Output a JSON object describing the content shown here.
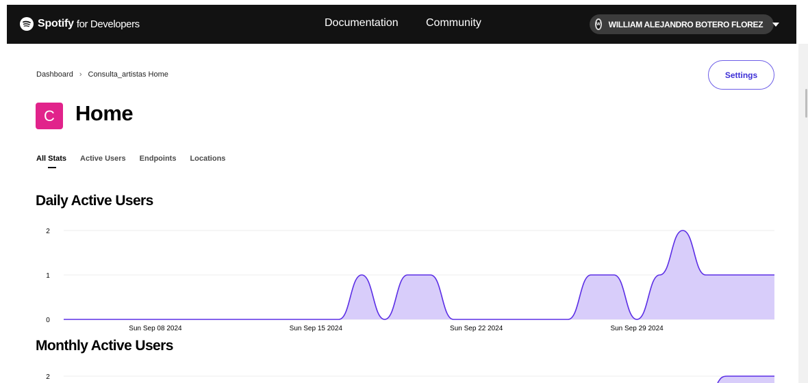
{
  "header": {
    "brand": "Spotify",
    "brand_sub": "for Developers",
    "nav": [
      "Documentation",
      "Community"
    ],
    "user": {
      "initial": "W",
      "name": "WILLIAM ALEJANDRO BOTERO FLOREZ"
    }
  },
  "breadcrumb": {
    "root": "Dashboard",
    "sep": "›",
    "current": "Consulta_artistas Home"
  },
  "settings_label": "Settings",
  "app": {
    "badge": "C",
    "title": "Home"
  },
  "tabs": [
    "All Stats",
    "Active Users",
    "Endpoints",
    "Locations"
  ],
  "active_tab": "All Stats",
  "sections": {
    "daily": "Daily Active Users",
    "monthly": "Monthly Active Users"
  },
  "colors": {
    "series_line": "#5b2ee5",
    "series_fill": "#d8cdfa",
    "badge": "#e1238b",
    "topbar": "#121212"
  },
  "chart_data": [
    {
      "type": "area",
      "title": "Daily Active Users",
      "x_ticks": [
        "Sun Sep 08 2024",
        "Sun Sep 15 2024",
        "Sun Sep 22 2024",
        "Sun Sep 29 2024"
      ],
      "y_ticks": [
        "0",
        "1",
        "2"
      ],
      "ylim": [
        0,
        2
      ],
      "x_start": "2024-09-04",
      "x_end": "2024-10-05",
      "x": [
        "2024-09-04",
        "2024-09-05",
        "2024-09-06",
        "2024-09-07",
        "2024-09-08",
        "2024-09-09",
        "2024-09-10",
        "2024-09-11",
        "2024-09-12",
        "2024-09-13",
        "2024-09-14",
        "2024-09-15",
        "2024-09-16",
        "2024-09-17",
        "2024-09-18",
        "2024-09-19",
        "2024-09-20",
        "2024-09-21",
        "2024-09-22",
        "2024-09-23",
        "2024-09-24",
        "2024-09-25",
        "2024-09-26",
        "2024-09-27",
        "2024-09-28",
        "2024-09-29",
        "2024-09-30",
        "2024-10-01",
        "2024-10-02",
        "2024-10-03",
        "2024-10-04",
        "2024-10-05"
      ],
      "values": [
        0,
        0,
        0,
        0,
        0,
        0,
        0,
        0,
        0,
        0,
        0,
        0,
        0,
        1,
        0,
        1,
        1,
        0,
        0,
        0,
        0,
        0,
        0,
        1,
        1,
        0,
        1,
        2,
        1,
        1,
        1,
        1
      ],
      "grid": true
    },
    {
      "type": "area",
      "title": "Monthly Active Users",
      "y_ticks": [
        "2"
      ],
      "partial": true
    }
  ]
}
